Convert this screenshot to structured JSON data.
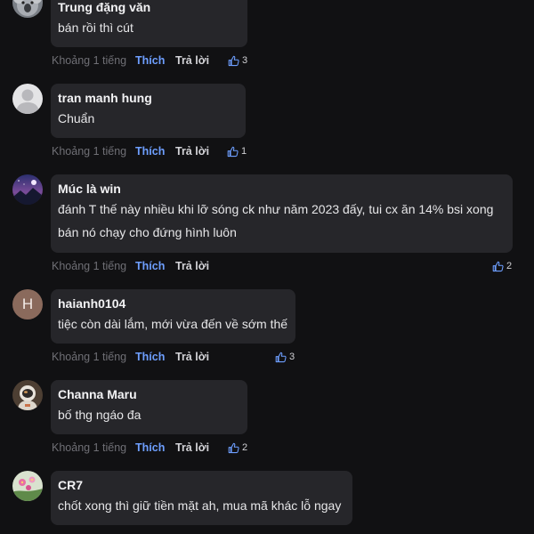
{
  "ui": {
    "like_label": "Thích",
    "reply_label": "Trả lời"
  },
  "comments": [
    {
      "author": "Trung đặng văn",
      "lines": [
        "bán rồi thì cút"
      ],
      "time": "Khoảng 1 tiếng",
      "likes": "3",
      "avatar": "photo-koala"
    },
    {
      "author": "tran manh hung",
      "lines": [
        "Chuẩn"
      ],
      "time": "Khoảng 1 tiếng",
      "likes": "1",
      "avatar": "default-user-icon"
    },
    {
      "author": "Múc là win",
      "lines": [
        "đánh T thế này nhiều khi lỡ sóng ck như năm 2023 đấy, tui cx ăn 14% bsi xong",
        "bán nó chạy cho đứng hình luôn"
      ],
      "time": "Khoảng 1 tiếng",
      "likes": "2",
      "avatar": "photo-night-sky"
    },
    {
      "author": "haianh0104",
      "lines": [
        "tiệc còn dài lắm, mới vừa đến về sớm thế"
      ],
      "time": "Khoảng 1 tiếng",
      "likes": "3",
      "avatar": "letter-avatar",
      "avatar_letter": "H",
      "avatar_color": "#8a6a5c"
    },
    {
      "author": "Channa Maru",
      "lines": [
        "bố thg ngáo đa"
      ],
      "time": "Khoảng 1 tiếng",
      "likes": "2",
      "avatar": "photo-astronaut"
    },
    {
      "author": "CR7",
      "lines": [
        "chốt xong thì giữ tiền mặt ah, mua mã khác lỗ ngay"
      ],
      "time": "",
      "likes": "",
      "avatar": "photo-flowers"
    }
  ],
  "colors": {
    "background": "#111113",
    "bubble": "#26262a",
    "like": "#6e9fff",
    "muted": "#6f6f75"
  }
}
